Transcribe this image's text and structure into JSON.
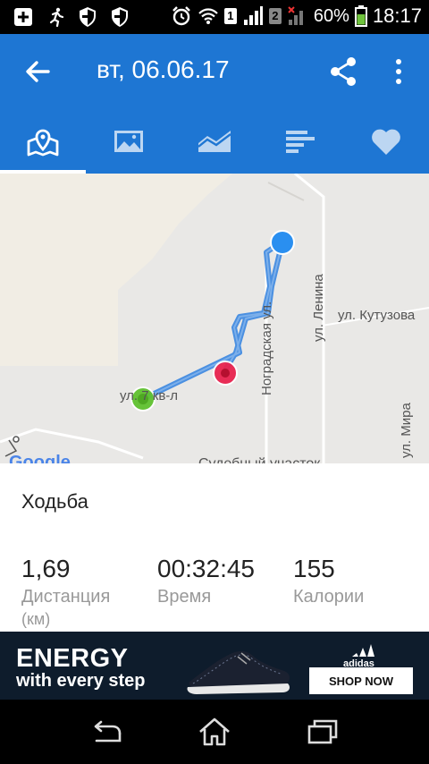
{
  "status_bar": {
    "battery_percent": "60%",
    "time": "18:17",
    "sim1": "1",
    "sim2": "2"
  },
  "header": {
    "title": "вт, 06.06.17",
    "back_icon": "arrow-back-icon",
    "share_icon": "share-icon",
    "more_icon": "more-vert-icon"
  },
  "tabs": [
    {
      "icon": "map-icon",
      "active": true
    },
    {
      "icon": "photo-icon",
      "active": false
    },
    {
      "icon": "chart-icon",
      "active": false
    },
    {
      "icon": "splits-icon",
      "active": false
    },
    {
      "icon": "heart-icon",
      "active": false
    }
  ],
  "map": {
    "labels": {
      "street_nogradskaya": "Ноградская ул.",
      "street_lenina": "ул. Ленина",
      "street_kutuzova": "ул. Кутузова",
      "street_mira": "ул. Мира",
      "quarter": "ул. 7 кв-л",
      "bottom": "Судебный участок",
      "google": "Google"
    },
    "colors": {
      "route": "#3a86e0",
      "start": "#5fc22f",
      "end": "#e8234f",
      "pin": "#2a8ff0"
    }
  },
  "activity": {
    "type": "Ходьба",
    "distance_value": "1,69",
    "distance_label": "Дистанция",
    "distance_unit_peek": "(км)",
    "time_value": "00:32:45",
    "time_label": "Время",
    "calories_value": "155",
    "calories_label": "Калории"
  },
  "ad": {
    "title": "ENERGY",
    "subtitle": "with every step",
    "brand": "adidas",
    "cta": "SHOP NOW"
  },
  "navbar": {
    "back": "nav-back-icon",
    "home": "nav-home-icon",
    "recents": "nav-recents-icon"
  },
  "colors": {
    "primary": "#1e76d3",
    "ad_bg": "#0e1c2c"
  }
}
